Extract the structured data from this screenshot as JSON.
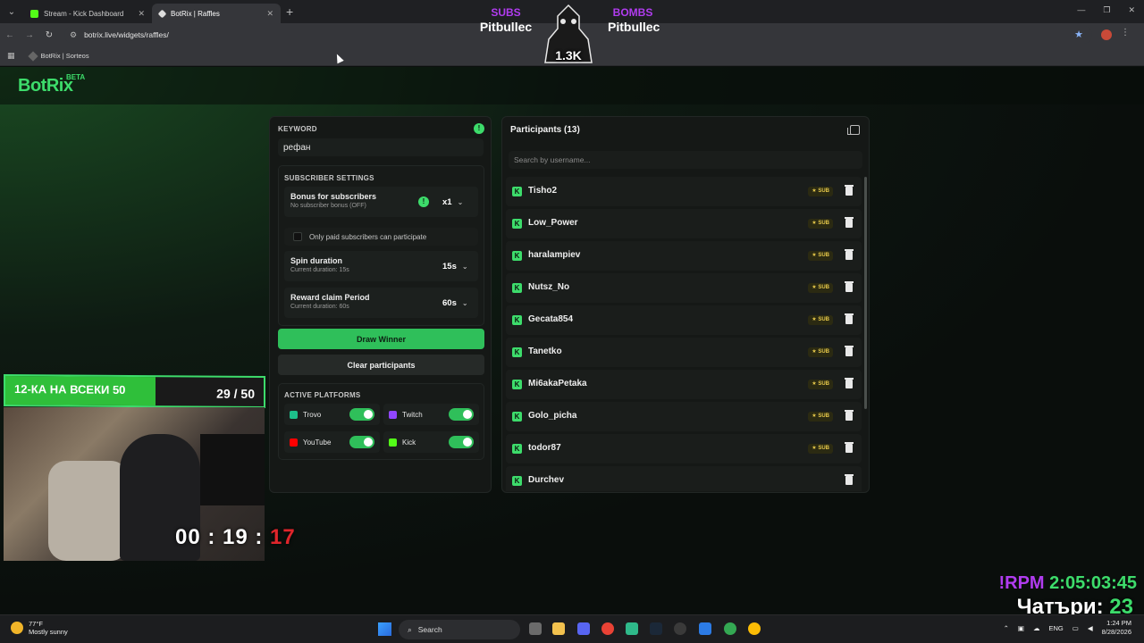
{
  "browser": {
    "tabs": [
      {
        "title": "Stream - Kick Dashboard",
        "active": false,
        "favicon_color": "#53fc18"
      },
      {
        "title": "BotRix | Raffles",
        "active": true,
        "favicon_color": "#dddddd"
      }
    ],
    "url": "botrix.live/widgets/raffles/",
    "bookmark": "BotRix | Sorteos"
  },
  "overlay": {
    "subs_label": "SUBS",
    "subs_name": "Pitbullec",
    "bombs_label": "BOMBS",
    "bombs_name": "Pitbullec",
    "count": "1.3K",
    "goal_text": "12-КА НА ВСЕКИ 50",
    "goal_count": "29 / 50",
    "goal_progress": 0.58,
    "timer_main": "00 : 19 : ",
    "timer_red": "17",
    "rpm_label": "!RPM ",
    "rpm_time": "2:05:03:45",
    "chatri_label": "Чатъри: ",
    "chatri_value": "23"
  },
  "app": {
    "logo": "BotRix",
    "logo_badge": "BETA"
  },
  "left": {
    "keyword_label": "KEYWORD",
    "keyword_value": "рефан",
    "subscriber_settings_label": "SUBSCRIBER SETTINGS",
    "bonus_title": "Bonus for subscribers",
    "bonus_sub": "No subscriber bonus (OFF)",
    "bonus_value": "x1",
    "paid_only_label": "Only paid subscribers can participate",
    "spin_title": "Spin duration",
    "spin_sub": "Current duration: 15s",
    "spin_value": "15s",
    "claim_title": "Reward claim Period",
    "claim_sub": "Current duration: 60s",
    "claim_value": "60s",
    "draw_button": "Draw Winner",
    "clear_button": "Clear participants",
    "platforms_label": "ACTIVE PLATFORMS",
    "platforms": [
      {
        "name": "Trovo",
        "color": "#1dbf8a",
        "enabled": true
      },
      {
        "name": "Twitch",
        "color": "#9146ff",
        "enabled": true
      },
      {
        "name": "YouTube",
        "color": "#ff0000",
        "enabled": true
      },
      {
        "name": "Kick",
        "color": "#53fc18",
        "enabled": true
      }
    ]
  },
  "right": {
    "title": "Participants (13)",
    "search_placeholder": "Search by username...",
    "sub_badge": "★ SUB",
    "participants": [
      {
        "name": "Tisho2",
        "sub": true
      },
      {
        "name": "Low_Power",
        "sub": true
      },
      {
        "name": "haralampiev",
        "sub": true
      },
      {
        "name": "Nutsz_No",
        "sub": true
      },
      {
        "name": "Gecata854",
        "sub": true
      },
      {
        "name": "Tanetko",
        "sub": true
      },
      {
        "name": "Mi6akaPetaka",
        "sub": true
      },
      {
        "name": "Golo_picha",
        "sub": true
      },
      {
        "name": "todor87",
        "sub": true
      },
      {
        "name": "Durchev",
        "sub": false
      }
    ]
  },
  "taskbar": {
    "temp": "77°F",
    "weather": "Mostly sunny",
    "search": "Search",
    "lang": "ENG",
    "time": "1:24 PM",
    "date": "8/28/2026"
  }
}
